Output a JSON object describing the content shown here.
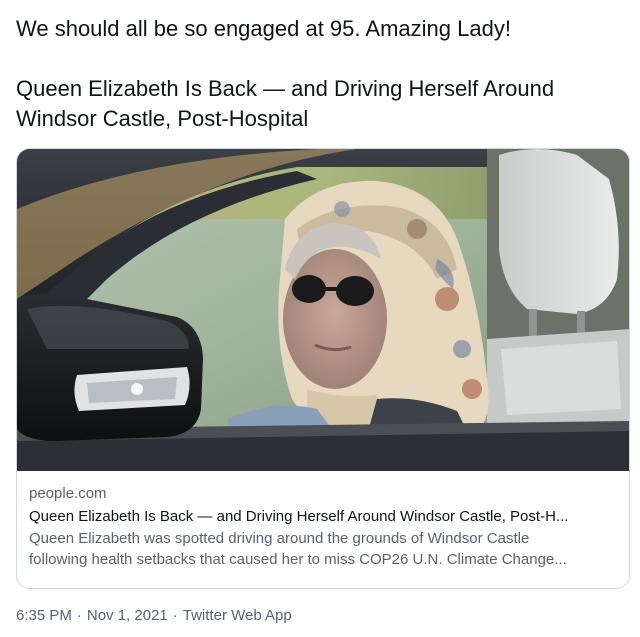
{
  "tweet": {
    "line1": "We should all be so engaged at 95.  Amazing Lady!",
    "line2": "Queen Elizabeth Is Back — and Driving Herself Around",
    "line3": "Windsor Castle, Post-Hospital"
  },
  "card": {
    "image_icon": "photo-of-woman-driving-car",
    "domain": "people.com",
    "title": "Queen Elizabeth Is Back — and Driving Herself Around Windsor Castle, Post-H...",
    "description_line1": "Queen Elizabeth was spotted driving around the grounds of Windsor Castle",
    "description_line2": "following health setbacks that caused her to miss COP26 U.N. Climate Change..."
  },
  "footer": {
    "time": "6:35 PM",
    "separator1": "·",
    "date": "Nov 1, 2021",
    "separator2": "·",
    "source": "Twitter Web App"
  }
}
